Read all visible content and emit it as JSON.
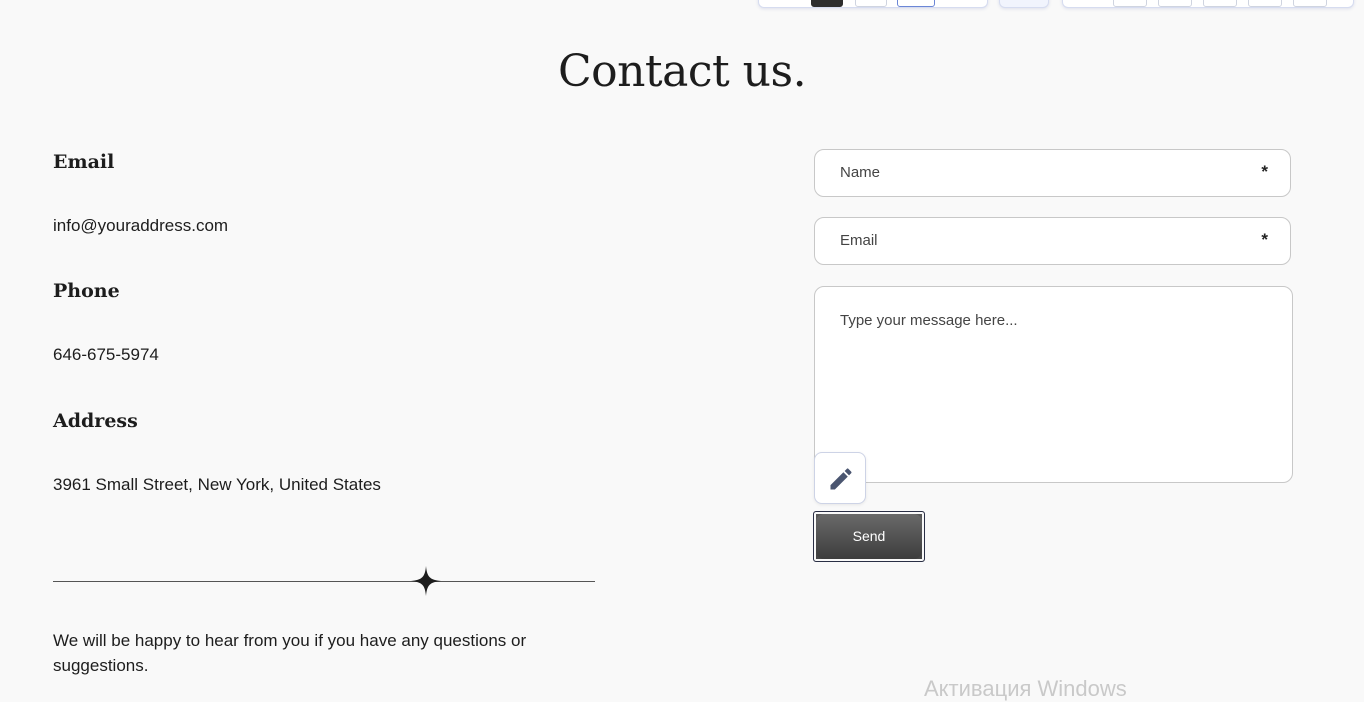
{
  "page": {
    "title": "Contact us."
  },
  "contact": {
    "email_label": "Email",
    "email_value": "info@youraddress.com",
    "phone_label": "Phone",
    "phone_value": "646-675-5974",
    "address_label": "Address",
    "address_value": "3961 Small Street, New York, United States",
    "message": "We will be happy to hear from you if you have any questions or suggestions."
  },
  "form": {
    "name_placeholder": "Name",
    "email_placeholder": "Email",
    "required_marker": "*",
    "message_placeholder": "Type your message here...",
    "send_label": "Send",
    "edit_icon": "pencil-icon"
  },
  "system": {
    "watermark": "Активация Windows"
  },
  "colors": {
    "background": "#f9f9f9",
    "text": "#1d1d1d",
    "send_button": "#4d4d4d"
  }
}
